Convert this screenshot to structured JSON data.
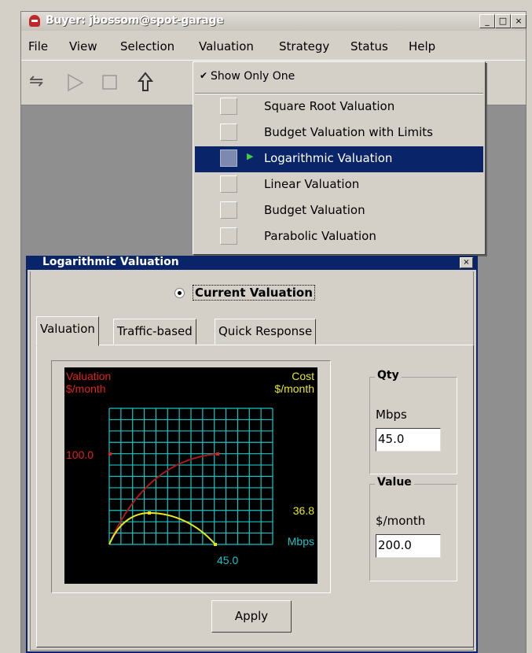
{
  "window": {
    "title": "Buyer: jbossom@spot-garage",
    "minimize": "_",
    "maximize": "□",
    "close": "×"
  },
  "menubar": [
    "File",
    "View",
    "Selection",
    "Valuation",
    "Strategy",
    "Status",
    "Help"
  ],
  "toolbar": {
    "icons": [
      "swap-arrows-icon",
      "play-icon",
      "stop-icon",
      "upload-arrow-icon"
    ]
  },
  "dropdown": {
    "show_only_one": {
      "check": "✔",
      "label": "Show Only One",
      "checked": true
    },
    "items": [
      {
        "label": "Square Root Valuation",
        "selected": false
      },
      {
        "label": "Budget Valuation with Limits",
        "selected": false
      },
      {
        "label": "Logarithmic Valuation",
        "selected": true
      },
      {
        "label": "Linear Valuation",
        "selected": false
      },
      {
        "label": "Budget Valuation",
        "selected": false
      },
      {
        "label": "Parabolic Valuation",
        "selected": false
      }
    ],
    "selected_marker": "▶"
  },
  "valuation_frame": {
    "title": "Logarithmic Valuation",
    "close": "×",
    "radio": {
      "label": "Current Valuation",
      "checked": true
    },
    "tabs": [
      "Valuation",
      "Traffic-based",
      "Quick Response"
    ],
    "active_tab": "Valuation",
    "graph": {
      "left_label_1": "Valuation",
      "left_label_2": "$/month",
      "right_label_1": "Cost",
      "right_label_2": "$/month",
      "value_mark": "100.0",
      "cost_mark": "36.8",
      "x_unit": "Mbps",
      "x_mark": "45.0",
      "colors": {
        "valuation": "#e0201c",
        "cost": "#e8e817",
        "grid": "#17c4c4",
        "background": "#000000"
      }
    },
    "qty": {
      "title": "Qty",
      "unit": "Mbps",
      "value": "45.0"
    },
    "value": {
      "title": "Value",
      "unit": "$/month",
      "value": "200.0"
    },
    "apply_label": "Apply"
  }
}
